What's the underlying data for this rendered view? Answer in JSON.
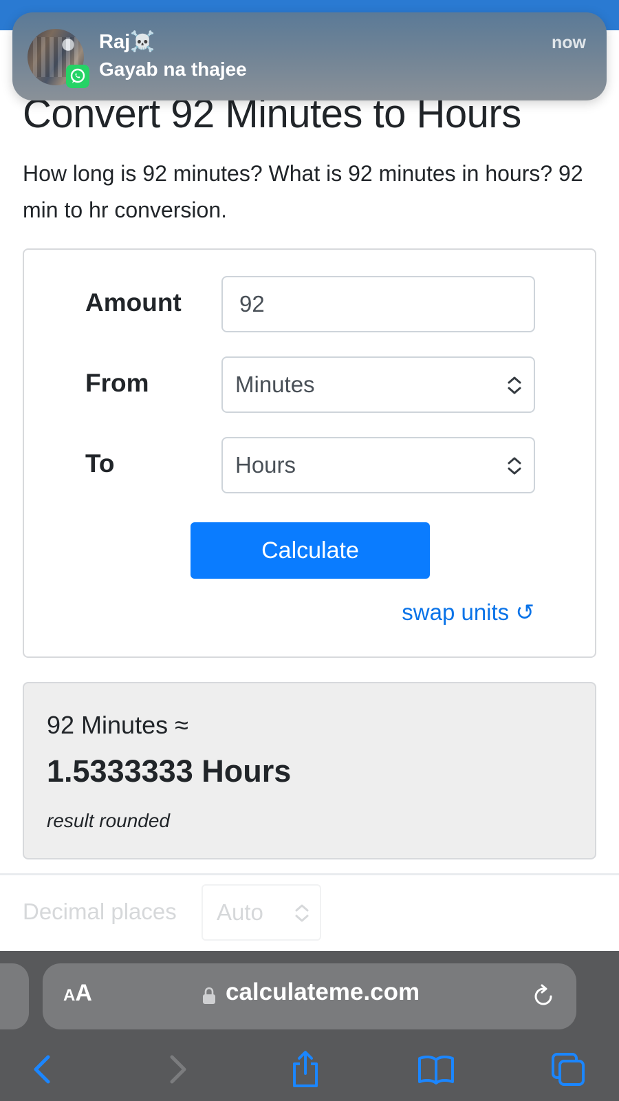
{
  "notification": {
    "sender": "Raj☠️",
    "message": "Gayab na thajee",
    "time": "now",
    "app_icon": "whatsapp-icon",
    "badge_color": "#25d366"
  },
  "page": {
    "title": "Convert 92 Minutes to Hours",
    "intro": "How long is 92 minutes? What is 92 minutes in hours? 92 min to hr conversion."
  },
  "form": {
    "amount_label": "Amount",
    "amount_value": "92",
    "from_label": "From",
    "from_value": "Minutes",
    "to_label": "To",
    "to_value": "Hours",
    "calculate_label": "Calculate",
    "swap_label": "swap units ↺",
    "accent_color": "#0a7cff"
  },
  "result": {
    "line1": "92 Minutes ≈",
    "line2": "1.5333333 Hours",
    "note": "result rounded"
  },
  "options": {
    "decimal_label": "Decimal places",
    "decimal_value": "Auto"
  },
  "browser": {
    "text_size_small": "A",
    "text_size_large": "A",
    "url": "calculateme.com",
    "toolbar": [
      "back-icon",
      "forward-icon",
      "share-icon",
      "bookmarks-icon",
      "tabs-icon"
    ]
  }
}
